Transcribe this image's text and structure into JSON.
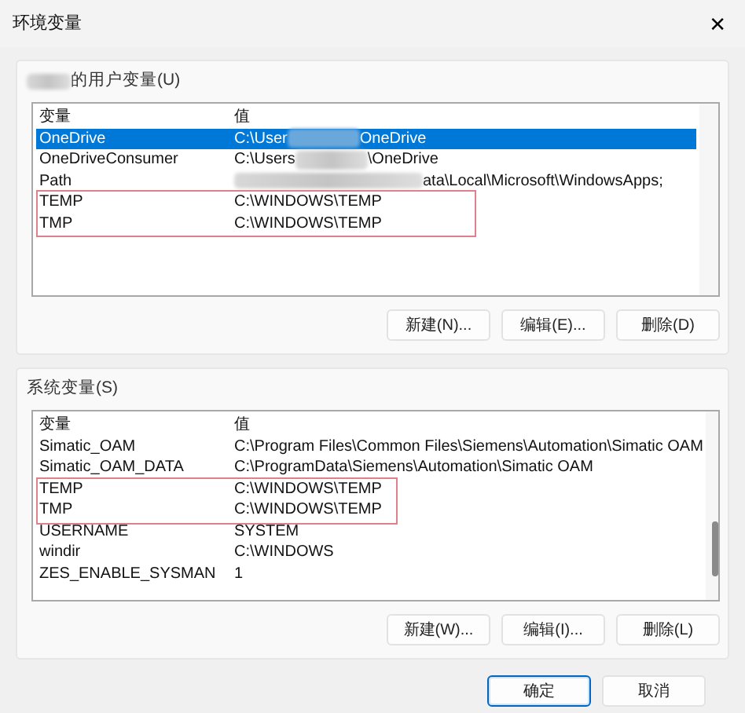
{
  "window": {
    "title": "环境变量",
    "close": "✕"
  },
  "user_vars": {
    "label": "的用户变量(U)",
    "label_blurred": true,
    "columns": [
      "变量",
      "值"
    ],
    "rows": [
      {
        "name": "OneDrive",
        "value_parts": [
          "C:\\User",
          "OneDrive"
        ],
        "selected": true,
        "highlighted": false
      },
      {
        "name": "OneDriveConsumer",
        "value_parts": [
          "C:\\Users",
          "\\OneDrive"
        ],
        "selected": false,
        "highlighted": false
      },
      {
        "name": "Path",
        "value_parts": [
          "ata\\Local\\Microsoft\\WindowsApps;"
        ],
        "blur_first": true,
        "selected": false,
        "highlighted": false
      },
      {
        "name": "TEMP",
        "value_parts": [
          "C:\\WINDOWS\\TEMP"
        ],
        "selected": false,
        "highlighted": true
      },
      {
        "name": "TMP",
        "value_parts": [
          "C:\\WINDOWS\\TEMP"
        ],
        "selected": false,
        "highlighted": true
      }
    ],
    "buttons": [
      "新建(N)...",
      "编辑(E)...",
      "删除(D)"
    ]
  },
  "system_vars": {
    "label": "系统变量(S)",
    "label_blurred": false,
    "columns": [
      "变量",
      "值"
    ],
    "rows": [
      {
        "name": "Simatic_OAM",
        "value_parts": [
          "C:\\Program Files\\Common Files\\Siemens\\Automation\\Simatic OAM"
        ],
        "selected": false,
        "highlighted": false
      },
      {
        "name": "Simatic_OAM_DATA",
        "value_parts": [
          "C:\\ProgramData\\Siemens\\Automation\\Simatic OAM"
        ],
        "selected": false,
        "highlighted": false
      },
      {
        "name": "TEMP",
        "value_parts": [
          "C:\\WINDOWS\\TEMP"
        ],
        "selected": false,
        "highlighted": true
      },
      {
        "name": "TMP",
        "value_parts": [
          "C:\\WINDOWS\\TEMP"
        ],
        "selected": false,
        "highlighted": true
      },
      {
        "name": "USERNAME",
        "value_parts": [
          "SYSTEM"
        ],
        "selected": false,
        "highlighted": false
      },
      {
        "name": "windir",
        "value_parts": [
          "C:\\WINDOWS"
        ],
        "selected": false,
        "highlighted": false
      },
      {
        "name": "ZES_ENABLE_SYSMAN",
        "value_parts": [
          "1"
        ],
        "selected": false,
        "highlighted": false
      }
    ],
    "buttons": [
      "新建(W)...",
      "编辑(I)...",
      "删除(L)"
    ]
  },
  "footer_buttons": [
    {
      "label": "确定",
      "default": true
    },
    {
      "label": "取消",
      "default": false
    }
  ]
}
